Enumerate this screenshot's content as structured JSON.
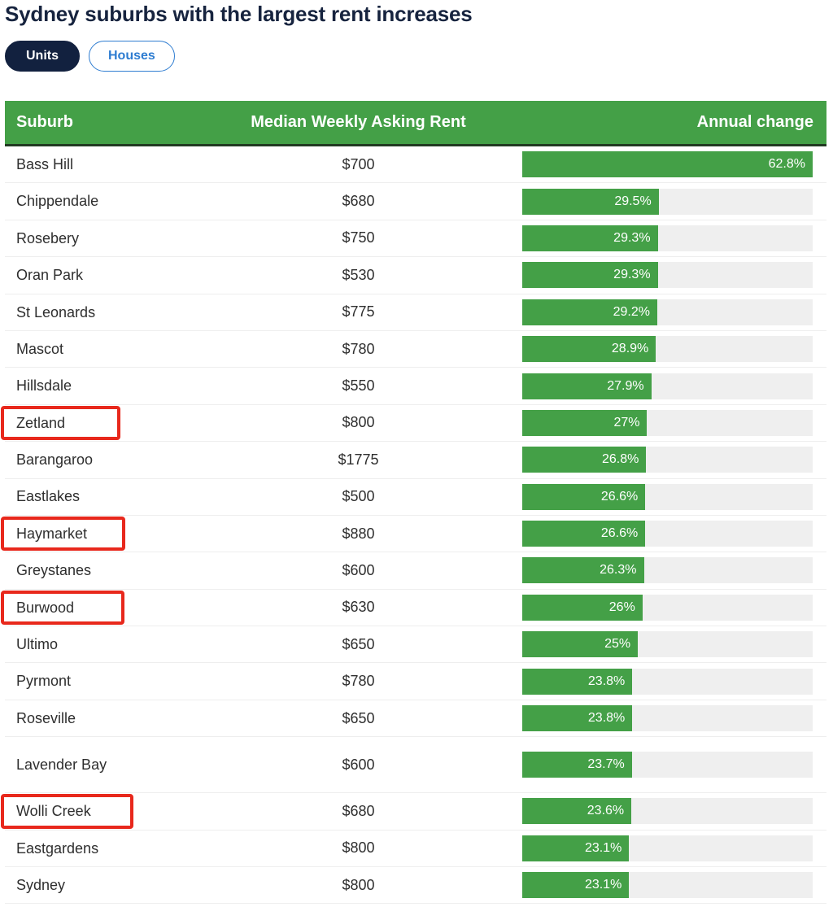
{
  "page": {
    "title": "Sydney suburbs with the largest rent increases"
  },
  "toggle": {
    "options": [
      {
        "label": "Units",
        "selected": true
      },
      {
        "label": "Houses",
        "selected": false
      }
    ]
  },
  "colors": {
    "title": "#17243f",
    "header_green": "#44a047",
    "bar_green": "#44a047",
    "bar_track": "#efefef",
    "pill_active_bg": "#12213f",
    "pill_inactive_text": "#2f7dd1",
    "highlight_red": "#e8281c"
  },
  "table": {
    "headers": {
      "suburb": "Suburb",
      "rent": "Median Weekly Asking Rent",
      "change": "Annual change"
    },
    "rows": [
      {
        "suburb": "Bass Hill",
        "rent": "$700",
        "change": "62.8%",
        "value": 62.8,
        "highlighted": false,
        "hl_width": 0,
        "tall": false
      },
      {
        "suburb": "Chippendale",
        "rent": "$680",
        "change": "29.5%",
        "value": 29.5,
        "highlighted": false,
        "hl_width": 0,
        "tall": false
      },
      {
        "suburb": "Rosebery",
        "rent": "$750",
        "change": "29.3%",
        "value": 29.3,
        "highlighted": false,
        "hl_width": 0,
        "tall": false
      },
      {
        "suburb": "Oran Park",
        "rent": "$530",
        "change": "29.3%",
        "value": 29.3,
        "highlighted": false,
        "hl_width": 0,
        "tall": false
      },
      {
        "suburb": "St Leonards",
        "rent": "$775",
        "change": "29.2%",
        "value": 29.2,
        "highlighted": false,
        "hl_width": 0,
        "tall": false
      },
      {
        "suburb": "Mascot",
        "rent": "$780",
        "change": "28.9%",
        "value": 28.9,
        "highlighted": false,
        "hl_width": 0,
        "tall": false
      },
      {
        "suburb": "Hillsdale",
        "rent": "$550",
        "change": "27.9%",
        "value": 27.9,
        "highlighted": false,
        "hl_width": 0,
        "tall": false
      },
      {
        "suburb": "Zetland",
        "rent": "$800",
        "change": "27%",
        "value": 27.0,
        "highlighted": true,
        "hl_width": 147,
        "tall": false
      },
      {
        "suburb": "Barangaroo",
        "rent": "$1775",
        "change": "26.8%",
        "value": 26.8,
        "highlighted": false,
        "hl_width": 0,
        "tall": false
      },
      {
        "suburb": "Eastlakes",
        "rent": "$500",
        "change": "26.6%",
        "value": 26.6,
        "highlighted": false,
        "hl_width": 0,
        "tall": false
      },
      {
        "suburb": "Haymarket",
        "rent": "$880",
        "change": "26.6%",
        "value": 26.6,
        "highlighted": true,
        "hl_width": 153,
        "tall": false
      },
      {
        "suburb": "Greystanes",
        "rent": "$600",
        "change": "26.3%",
        "value": 26.3,
        "highlighted": false,
        "hl_width": 0,
        "tall": false
      },
      {
        "suburb": "Burwood",
        "rent": "$630",
        "change": "26%",
        "value": 26.0,
        "highlighted": true,
        "hl_width": 152,
        "tall": false
      },
      {
        "suburb": "Ultimo",
        "rent": "$650",
        "change": "25%",
        "value": 25.0,
        "highlighted": false,
        "hl_width": 0,
        "tall": false
      },
      {
        "suburb": "Pyrmont",
        "rent": "$780",
        "change": "23.8%",
        "value": 23.8,
        "highlighted": false,
        "hl_width": 0,
        "tall": false
      },
      {
        "suburb": "Roseville",
        "rent": "$650",
        "change": "23.8%",
        "value": 23.8,
        "highlighted": false,
        "hl_width": 0,
        "tall": false
      },
      {
        "suburb": "Lavender Bay",
        "rent": "$600",
        "change": "23.7%",
        "value": 23.7,
        "highlighted": false,
        "hl_width": 0,
        "tall": true
      },
      {
        "suburb": "Wolli Creek",
        "rent": "$680",
        "change": "23.6%",
        "value": 23.6,
        "highlighted": true,
        "hl_width": 163,
        "tall": false
      },
      {
        "suburb": "Eastgardens",
        "rent": "$800",
        "change": "23.1%",
        "value": 23.1,
        "highlighted": false,
        "hl_width": 0,
        "tall": false
      },
      {
        "suburb": "Sydney",
        "rent": "$800",
        "change": "23.1%",
        "value": 23.1,
        "highlighted": false,
        "hl_width": 0,
        "tall": false
      }
    ]
  },
  "chart_data": {
    "type": "table",
    "title": "Sydney suburbs with the largest rent increases",
    "subtitle": "Units",
    "columns": [
      "Suburb",
      "Median Weekly Asking Rent",
      "Annual change"
    ],
    "categories": [
      "Bass Hill",
      "Chippendale",
      "Rosebery",
      "Oran Park",
      "St Leonards",
      "Mascot",
      "Hillsdale",
      "Zetland",
      "Barangaroo",
      "Eastlakes",
      "Haymarket",
      "Greystanes",
      "Burwood",
      "Ultimo",
      "Pyrmont",
      "Roseville",
      "Lavender Bay",
      "Wolli Creek",
      "Eastgardens",
      "Sydney"
    ],
    "series": [
      {
        "name": "Median Weekly Asking Rent",
        "unit": "AUD per week",
        "values": [
          700,
          680,
          750,
          530,
          775,
          780,
          550,
          800,
          1775,
          500,
          880,
          600,
          630,
          650,
          780,
          650,
          600,
          680,
          800,
          800
        ]
      },
      {
        "name": "Annual change",
        "unit": "%",
        "values": [
          62.8,
          29.5,
          29.3,
          29.3,
          29.2,
          28.9,
          27.9,
          27.0,
          26.8,
          26.6,
          26.6,
          26.3,
          26.0,
          25.0,
          23.8,
          23.8,
          23.7,
          23.6,
          23.1,
          23.1
        ]
      }
    ],
    "bar_max": 62.8,
    "xlabel": "",
    "ylabel": "",
    "grid": false,
    "legend": "none",
    "annotations": [
      {
        "type": "highlight-box",
        "target": "Zetland",
        "color": "#e8281c"
      },
      {
        "type": "highlight-box",
        "target": "Haymarket",
        "color": "#e8281c"
      },
      {
        "type": "highlight-box",
        "target": "Burwood",
        "color": "#e8281c"
      },
      {
        "type": "highlight-box",
        "target": "Wolli Creek",
        "color": "#e8281c"
      }
    ]
  }
}
